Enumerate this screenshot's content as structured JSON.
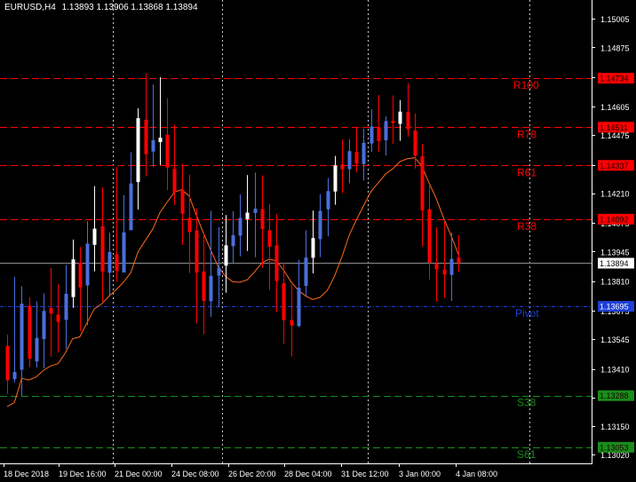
{
  "header": {
    "symbol": "EURUSD,H4",
    "ohlc": "1.13893 1.13906 1.13868 1.13894"
  },
  "colors": {
    "background": "#000000",
    "foreground": "#ffffff",
    "bull_candle": "#ffffff",
    "bear_candle": "#ff0000",
    "bull_trend_candle": "#4a6fdc",
    "moving_average": "#ff6a1a",
    "resistance_line": "#ff0000",
    "support_line": "#1a8c1a",
    "pivot_line": "#1f3fd6",
    "current_price_line": "#8c8c8c",
    "grid_vertical": "#c8c8c8"
  },
  "chart_data": {
    "type": "candlestick",
    "symbol": "EURUSD",
    "timeframe": "H4",
    "ylim": [
      1.1302,
      1.1505
    ],
    "y_ticks": [
      "1.15005",
      "1.14875",
      "1.14740",
      "1.14605",
      "1.14475",
      "1.14340",
      "1.14210",
      "1.14075",
      "1.13945",
      "1.13810",
      "1.13675",
      "1.13545",
      "1.13410",
      "1.13280",
      "1.13150",
      "1.13020"
    ],
    "x_tick_labels": [
      "18 Dec 2018",
      "19 Dec 16:00",
      "21 Dec 00:00",
      "24 Dec 08:00",
      "26 Dec 20:00",
      "28 Dec 04:00",
      "31 Dec 12:00",
      "3 Jan 00:00",
      "4 Jan 08:00"
    ],
    "current_price": {
      "value": 1.13894,
      "label": "1.13894"
    },
    "levels": [
      {
        "name": "R100",
        "value": 1.14734,
        "tag": "1.14734",
        "kind": "resistance"
      },
      {
        "name": "R78",
        "value": 1.14511,
        "tag": "1.14511",
        "kind": "resistance"
      },
      {
        "name": "R61",
        "value": 1.14337,
        "tag": "1.14337",
        "kind": "resistance"
      },
      {
        "name": "R38",
        "value": 1.14092,
        "tag": "1.14092",
        "kind": "resistance"
      },
      {
        "name": "Pivot",
        "value": 1.13695,
        "tag": "1.13695",
        "kind": "pivot"
      },
      {
        "name": "S38",
        "value": 1.13288,
        "tag": "1.13288",
        "kind": "support"
      },
      {
        "name": "S61",
        "value": 1.13053,
        "tag": "1.13053",
        "kind": "support"
      }
    ],
    "candles": [
      [
        1.13515,
        1.13567,
        1.13296,
        1.13358
      ],
      [
        1.13363,
        1.13829,
        1.13348,
        1.13396
      ],
      [
        1.13406,
        1.13787,
        1.13287,
        1.13707
      ],
      [
        1.13698,
        1.13736,
        1.13418,
        1.13456
      ],
      [
        1.13444,
        1.13718,
        1.13416,
        1.13551
      ],
      [
        1.13546,
        1.13754,
        1.13412,
        1.13674
      ],
      [
        1.13688,
        1.1387,
        1.13466,
        1.13662
      ],
      [
        1.13657,
        1.13797,
        1.13484,
        1.13624
      ],
      [
        1.13633,
        1.13883,
        1.13501,
        1.13752
      ],
      [
        1.13737,
        1.13999,
        1.13689,
        1.13909
      ],
      [
        1.13893,
        1.13965,
        1.13581,
        1.13781
      ],
      [
        1.1379,
        1.14083,
        1.13609,
        1.13981
      ],
      [
        1.13975,
        1.14243,
        1.13854,
        1.14049
      ],
      [
        1.14059,
        1.14237,
        1.13716,
        1.13853
      ],
      [
        1.13848,
        1.1403,
        1.13741,
        1.13942
      ],
      [
        1.13932,
        1.14329,
        1.13806,
        1.13856
      ],
      [
        1.13849,
        1.14202,
        1.1385,
        1.14032
      ],
      [
        1.14042,
        1.14397,
        1.14041,
        1.14255
      ],
      [
        1.14261,
        1.14597,
        1.14136,
        1.14552
      ],
      [
        1.14545,
        1.14756,
        1.14287,
        1.14388
      ],
      [
        1.144,
        1.14706,
        1.14331,
        1.14452
      ],
      [
        1.14443,
        1.14739,
        1.14339,
        1.14463
      ],
      [
        1.14477,
        1.14643,
        1.14224,
        1.14327
      ],
      [
        1.14321,
        1.14523,
        1.14157,
        1.14215
      ],
      [
        1.14225,
        1.14344,
        1.13975,
        1.14117
      ],
      [
        1.14099,
        1.14295,
        1.13847,
        1.14033
      ],
      [
        1.14041,
        1.14141,
        1.13617,
        1.13849
      ],
      [
        1.13854,
        1.14031,
        1.13568,
        1.1372
      ],
      [
        1.13718,
        1.1413,
        1.13647,
        1.13834
      ],
      [
        1.13835,
        1.14055,
        1.13691,
        1.13871
      ],
      [
        1.1388,
        1.14111,
        1.13757,
        1.13973
      ],
      [
        1.13969,
        1.14129,
        1.13891,
        1.14019
      ],
      [
        1.14017,
        1.14205,
        1.13923,
        1.14098
      ],
      [
        1.14092,
        1.14293,
        1.13947,
        1.14122
      ],
      [
        1.1412,
        1.14304,
        1.13919,
        1.1414
      ],
      [
        1.14138,
        1.14292,
        1.1387,
        1.14047
      ],
      [
        1.14042,
        1.14161,
        1.13769,
        1.13966
      ],
      [
        1.13973,
        1.14115,
        1.13668,
        1.1381
      ],
      [
        1.138,
        1.13893,
        1.13524,
        1.13632
      ],
      [
        1.13633,
        1.13795,
        1.13467,
        1.13608
      ],
      [
        1.13605,
        1.13907,
        1.136,
        1.1378
      ],
      [
        1.13788,
        1.14041,
        1.13741,
        1.13917
      ],
      [
        1.13916,
        1.14131,
        1.13845,
        1.14006
      ],
      [
        1.14001,
        1.14206,
        1.13919,
        1.1413
      ],
      [
        1.14137,
        1.14279,
        1.14014,
        1.1422
      ],
      [
        1.14218,
        1.1438,
        1.14158,
        1.14337
      ],
      [
        1.14342,
        1.14456,
        1.1421,
        1.14319
      ],
      [
        1.1432,
        1.14456,
        1.14256,
        1.14402
      ],
      [
        1.14398,
        1.14513,
        1.14305,
        1.14345
      ],
      [
        1.14343,
        1.14504,
        1.14268,
        1.1444
      ],
      [
        1.14437,
        1.14593,
        1.14399,
        1.14514
      ],
      [
        1.1451,
        1.14657,
        1.144,
        1.14447
      ],
      [
        1.14451,
        1.1456,
        1.14382,
        1.14539
      ],
      [
        1.1454,
        1.14655,
        1.14434,
        1.1453
      ],
      [
        1.14526,
        1.14634,
        1.14449,
        1.14582
      ],
      [
        1.1458,
        1.14712,
        1.14467,
        1.14501
      ],
      [
        1.14496,
        1.14574,
        1.14323,
        1.14381
      ],
      [
        1.14378,
        1.14435,
        1.13968,
        1.14132
      ],
      [
        1.14137,
        1.14246,
        1.13817,
        1.13893
      ],
      [
        1.13888,
        1.14055,
        1.13716,
        1.13864
      ],
      [
        1.13862,
        1.1408,
        1.13733,
        1.1384
      ],
      [
        1.13838,
        1.14031,
        1.13719,
        1.13911
      ],
      [
        1.13917,
        1.14019,
        1.13853,
        1.13894
      ]
    ]
  }
}
